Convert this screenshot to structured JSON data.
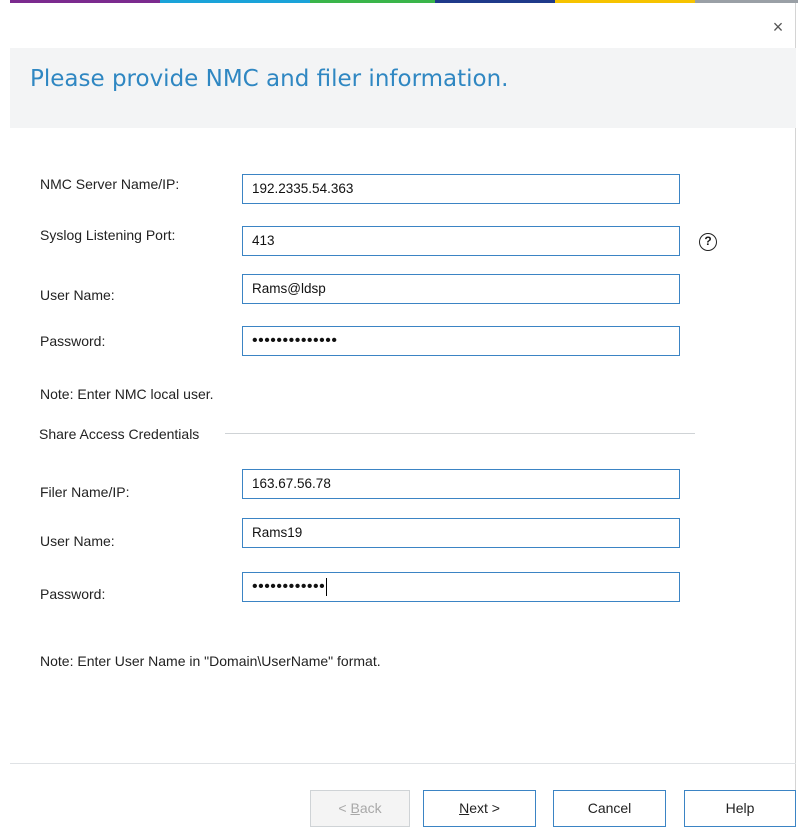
{
  "colors": {
    "accent_strip": [
      "#7b2a8e",
      "#1aa3d9",
      "#3ab54a",
      "#1f3a8a",
      "#f6c300",
      "#9aa0a6"
    ],
    "title": "#2f87c2",
    "field_border": "#3b84c4"
  },
  "window": {
    "close_glyph": "×"
  },
  "header": {
    "title": "Please provide NMC and filer information."
  },
  "nmc": {
    "server_label": "NMC Server Name/IP:",
    "server_value": "192.2335.54.363",
    "port_label": "Syslog Listening Port:",
    "port_value": "413",
    "port_help_glyph": "?",
    "user_label": "User Name:",
    "user_value": "Rams@ldsp",
    "password_label": "Password:",
    "password_masked": "••••••••••••••",
    "note": "Note: Enter NMC local user."
  },
  "share": {
    "group_title": "Share Access Credentials",
    "filer_label": "Filer Name/IP:",
    "filer_value": "163.67.56.78",
    "user_label": "User Name:",
    "user_value": "Rams19",
    "password_label": "Password:",
    "password_masked": "••••••••••••",
    "note": "Note: Enter User Name in \"Domain\\UserName\" format."
  },
  "footer": {
    "back": {
      "prefix": "< ",
      "mnemonic": "B",
      "rest": "ack"
    },
    "next": {
      "mnemonic": "N",
      "rest": "ext >"
    },
    "cancel": "Cancel",
    "help": "Help"
  }
}
